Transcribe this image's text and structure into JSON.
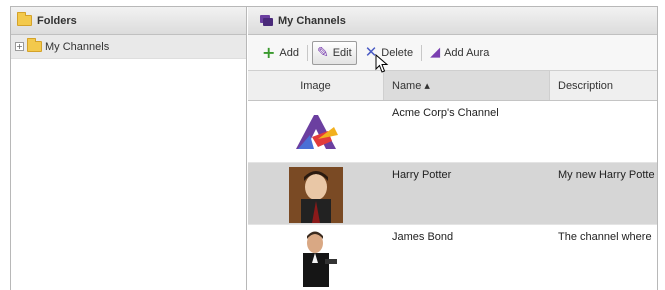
{
  "left_panel": {
    "header": "Folders",
    "tree": [
      {
        "label": "My Channels",
        "expander": "+"
      }
    ]
  },
  "right_panel": {
    "header": "My Channels",
    "toolbar": {
      "add": "Add",
      "edit": "Edit",
      "delete": "Delete",
      "add_aura": "Add Aura"
    },
    "columns": {
      "image": "Image",
      "name": "Name ▴",
      "description": "Description"
    },
    "rows": [
      {
        "name": "Acme Corp's Channel",
        "description": "",
        "thumbnail": "acme-logo"
      },
      {
        "name": "Harry Potter",
        "description": "My new Harry Potte",
        "thumbnail": "harry-potter-photo"
      },
      {
        "name": "James Bond",
        "description": "The channel where",
        "thumbnail": "james-bond-photo"
      }
    ]
  },
  "colors": {
    "accent_purple": "#7a3fb0",
    "add_green": "#3a9a2e",
    "delete_blue": "#4a5bc4",
    "selected_row": "#d6d6d6"
  }
}
